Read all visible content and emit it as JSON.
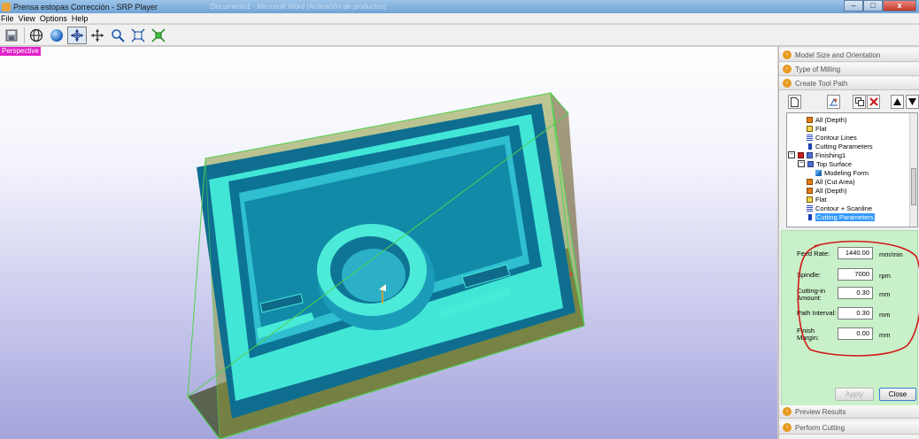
{
  "window": {
    "title": "Prensa estopas Corrección - SRP Player",
    "ghost_text": "Documento1 - Microsoft Word (Activación de productos)",
    "buttons": {
      "minimize": "–",
      "maximize": "□",
      "close": "x"
    }
  },
  "menu": [
    "File",
    "View",
    "Options",
    "Help"
  ],
  "toolbar": {
    "icons": [
      "save-icon",
      "globe-icon",
      "sphere-icon",
      "rotate-icon",
      "pan-icon",
      "zoom-icon",
      "fit-icon",
      "fit-all-icon"
    ],
    "active": "rotate-icon"
  },
  "viewport": {
    "view_label": "Perspective",
    "colors": {
      "part": "#40e8d8",
      "part_dark": "#0f7a9a",
      "stock": "#8a9a3a",
      "stock_edge": "#4ed04e"
    }
  },
  "panel": {
    "sections": {
      "model_size": "Model Size and Orientation",
      "type_of_milling": "Type of Milling",
      "create_tool_path": "Create Tool Path",
      "preview_results": "Preview Results",
      "perform_cutting": "Perform Cutting"
    },
    "tree": [
      {
        "label": "All (Depth)",
        "icon": "orange-box-icon",
        "level": 2
      },
      {
        "label": "Flat",
        "icon": "flat-tool-icon",
        "level": 2
      },
      {
        "label": "Contour Lines",
        "icon": "contour-icon",
        "level": 2
      },
      {
        "label": "Cutting Parameters",
        "icon": "info-icon",
        "level": 2
      },
      {
        "label": "Finishing1",
        "icon": "finishing-icon",
        "level": 0
      },
      {
        "label": "Top Surface",
        "icon": "surface-icon",
        "level": 1
      },
      {
        "label": "Modeling Form",
        "icon": "form-icon",
        "level": 2
      },
      {
        "label": "All (Cut Area)",
        "icon": "orange-box-icon",
        "level": 1
      },
      {
        "label": "All (Depth)",
        "icon": "orange-box-icon",
        "level": 1
      },
      {
        "label": "Flat",
        "icon": "flat-tool-icon",
        "level": 1
      },
      {
        "label": "Contour + Scanline",
        "icon": "contour-icon",
        "level": 1
      },
      {
        "label": "Cutting Parameters",
        "icon": "info-icon",
        "level": 1,
        "selected": true
      }
    ],
    "params": [
      {
        "label": "Feed Rate:",
        "value": "1440.00",
        "unit": "mm/min"
      },
      {
        "label": "Spindle:",
        "value": "7000",
        "unit": "rpm"
      },
      {
        "label": "Cutting-in Amount:",
        "value": "0.30",
        "unit": "mm"
      },
      {
        "label": "Path Interval:",
        "value": "0.30",
        "unit": "mm"
      },
      {
        "label": "Finish Margin:",
        "value": "0.00",
        "unit": "mm"
      }
    ],
    "apply_label": "Apply",
    "close_label": "Close",
    "annotation_color": "#d01818",
    "params_bg": "#c9f1c9"
  }
}
